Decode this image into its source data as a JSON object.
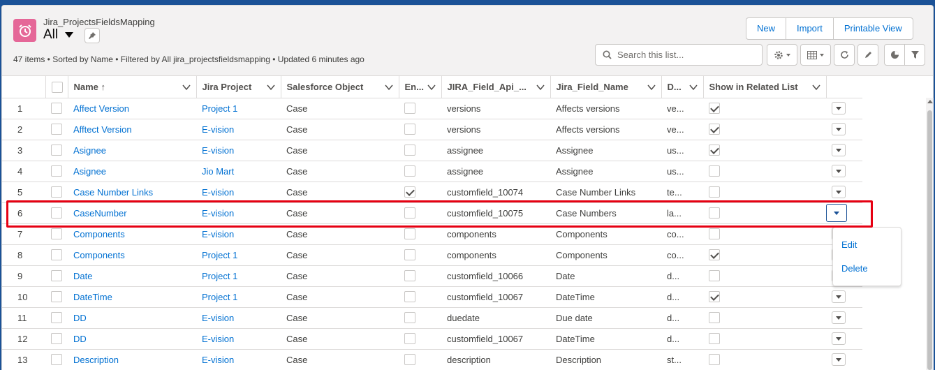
{
  "header": {
    "object_name": "Jira_ProjectsFieldsMapping",
    "list_view": "All",
    "meta": "47 items • Sorted by Name • Filtered by All jira_projectsfieldsmapping • Updated 6 minutes ago",
    "buttons": {
      "new": "New",
      "import": "Import",
      "printable": "Printable View"
    },
    "search_placeholder": "Search this list..."
  },
  "icons": {
    "object": "alarm-clock-icon",
    "pin": "pin-icon",
    "search": "search-icon",
    "gear": "gear-icon",
    "columns": "table-columns-icon",
    "refresh": "refresh-icon",
    "edit": "pencil-icon",
    "chart": "pie-chart-icon",
    "filter": "filter-icon"
  },
  "colors": {
    "brand": "#1b5297",
    "link": "#0070d2",
    "object_icon": "#e56798",
    "highlight": "#e60012"
  },
  "table": {
    "columns": [
      "Name ↑",
      "Jira Project",
      "Salesforce Object",
      "En...",
      "JIRA_Field_Api_...",
      "Jira_Field_Name",
      "D...",
      "Show in Related List"
    ],
    "rows": [
      {
        "num": "1",
        "name": "Affect Version",
        "project": "Project 1",
        "object": "Case",
        "enabled": false,
        "api": "versions",
        "field": "Affects versions",
        "d": "ve...",
        "show": true
      },
      {
        "num": "2",
        "name": "Afftect Version",
        "project": "E-vision",
        "object": "Case",
        "enabled": false,
        "api": "versions",
        "field": "Affects versions",
        "d": "ve...",
        "show": true
      },
      {
        "num": "3",
        "name": "Asignee",
        "project": "E-vision",
        "object": "Case",
        "enabled": false,
        "api": "assignee",
        "field": "Assignee",
        "d": "us...",
        "show": true
      },
      {
        "num": "4",
        "name": "Asignee",
        "project": "Jio Mart",
        "object": "Case",
        "enabled": false,
        "api": "assignee",
        "field": "Assignee",
        "d": "us...",
        "show": false
      },
      {
        "num": "5",
        "name": "Case Number Links",
        "project": "E-vision",
        "object": "Case",
        "enabled": true,
        "api": "customfield_10074",
        "field": "Case Number Links",
        "d": "te...",
        "show": false
      },
      {
        "num": "6",
        "name": "CaseNumber",
        "project": "E-vision",
        "object": "Case",
        "enabled": false,
        "api": "customfield_10075",
        "field": "Case Numbers",
        "d": "la...",
        "show": false
      },
      {
        "num": "7",
        "name": "Components",
        "project": "E-vision",
        "object": "Case",
        "enabled": false,
        "api": "components",
        "field": "Components",
        "d": "co...",
        "show": false
      },
      {
        "num": "8",
        "name": "Components",
        "project": "Project 1",
        "object": "Case",
        "enabled": false,
        "api": "components",
        "field": "Components",
        "d": "co...",
        "show": true
      },
      {
        "num": "9",
        "name": "Date",
        "project": "Project 1",
        "object": "Case",
        "enabled": false,
        "api": "customfield_10066",
        "field": "Date",
        "d": "d...",
        "show": false
      },
      {
        "num": "10",
        "name": "DateTime",
        "project": "Project 1",
        "object": "Case",
        "enabled": false,
        "api": "customfield_10067",
        "field": "DateTime",
        "d": "d...",
        "show": true
      },
      {
        "num": "11",
        "name": "DD",
        "project": "E-vision",
        "object": "Case",
        "enabled": false,
        "api": "duedate",
        "field": "Due date",
        "d": "d...",
        "show": false
      },
      {
        "num": "12",
        "name": "DD",
        "project": "E-vision",
        "object": "Case",
        "enabled": false,
        "api": "customfield_10067",
        "field": "DateTime",
        "d": "d...",
        "show": false
      },
      {
        "num": "13",
        "name": "Description",
        "project": "E-vision",
        "object": "Case",
        "enabled": false,
        "api": "description",
        "field": "Description",
        "d": "st...",
        "show": false
      }
    ]
  },
  "row_menu": {
    "edit": "Edit",
    "delete": "Delete"
  }
}
